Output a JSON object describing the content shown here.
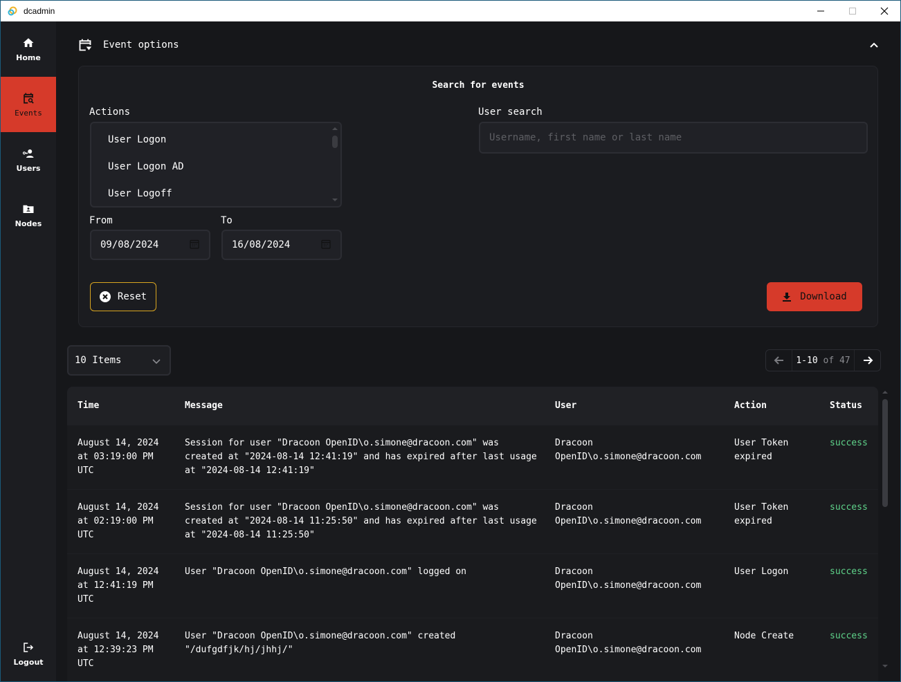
{
  "window": {
    "title": "dcadmin"
  },
  "sidebar": {
    "items": [
      {
        "label": "Home",
        "icon": "home-icon",
        "active": false
      },
      {
        "label": "Events",
        "icon": "calendar-search-icon",
        "active": true
      },
      {
        "label": "Users",
        "icon": "user-key-icon",
        "active": false
      },
      {
        "label": "Nodes",
        "icon": "folder-user-icon",
        "active": false
      }
    ],
    "logout_label": "Logout"
  },
  "event_options": {
    "title": "Event options",
    "panel_title": "Search for events",
    "actions_label": "Actions",
    "actions_options": [
      "User Logon",
      "User Logon AD",
      "User Logoff"
    ],
    "user_search_label": "User search",
    "user_search_placeholder": "Username, first name or last name",
    "user_search_value": "",
    "from_label": "From",
    "from_value": "09/08/2024",
    "to_label": "To",
    "to_value": "16/08/2024",
    "reset_label": "Reset",
    "download_label": "Download"
  },
  "pagination": {
    "items_per_page": "10 Items",
    "range": "1-10",
    "of_label": "of",
    "total": "47"
  },
  "table": {
    "columns": [
      "Time",
      "Message",
      "User",
      "Action",
      "Status"
    ],
    "rows": [
      {
        "time": "August 14, 2024\nat 03:19:00 PM\nUTC",
        "message": "Session for user \"Dracoon OpenID\\o.simone@dracoon.com\" was\ncreated at \"2024-08-14 12:41:19\" and has expired after last usage\nat \"2024-08-14 12:41:19\"",
        "user": "Dracoon\nOpenID\\o.simone@dracoon.com",
        "action": "User Token\nexpired",
        "status": "success"
      },
      {
        "time": "August 14, 2024\nat 02:19:00 PM\nUTC",
        "message": "Session for user \"Dracoon OpenID\\o.simone@dracoon.com\" was\ncreated at \"2024-08-14 11:25:50\" and has expired after last usage\nat \"2024-08-14 11:25:50\"",
        "user": "Dracoon\nOpenID\\o.simone@dracoon.com",
        "action": "User Token\nexpired",
        "status": "success"
      },
      {
        "time": "August 14, 2024\nat 12:41:19 PM\nUTC",
        "message": "User \"Dracoon OpenID\\o.simone@dracoon.com\" logged on",
        "user": "Dracoon\nOpenID\\o.simone@dracoon.com",
        "action": "User Logon",
        "status": "success"
      },
      {
        "time": "August 14, 2024\nat 12:39:23 PM\nUTC",
        "message": "User \"Dracoon OpenID\\o.simone@dracoon.com\" created\n\"/dufgdfjk/hj/jhhj/\"",
        "user": "Dracoon\nOpenID\\o.simone@dracoon.com",
        "action": "Node Create",
        "status": "success"
      }
    ]
  },
  "colors": {
    "accent": "#d63a2a",
    "reset_border": "#d9a520",
    "success": "#5fd38a",
    "background": "#16171a",
    "sidebar": "#1c1d21"
  }
}
